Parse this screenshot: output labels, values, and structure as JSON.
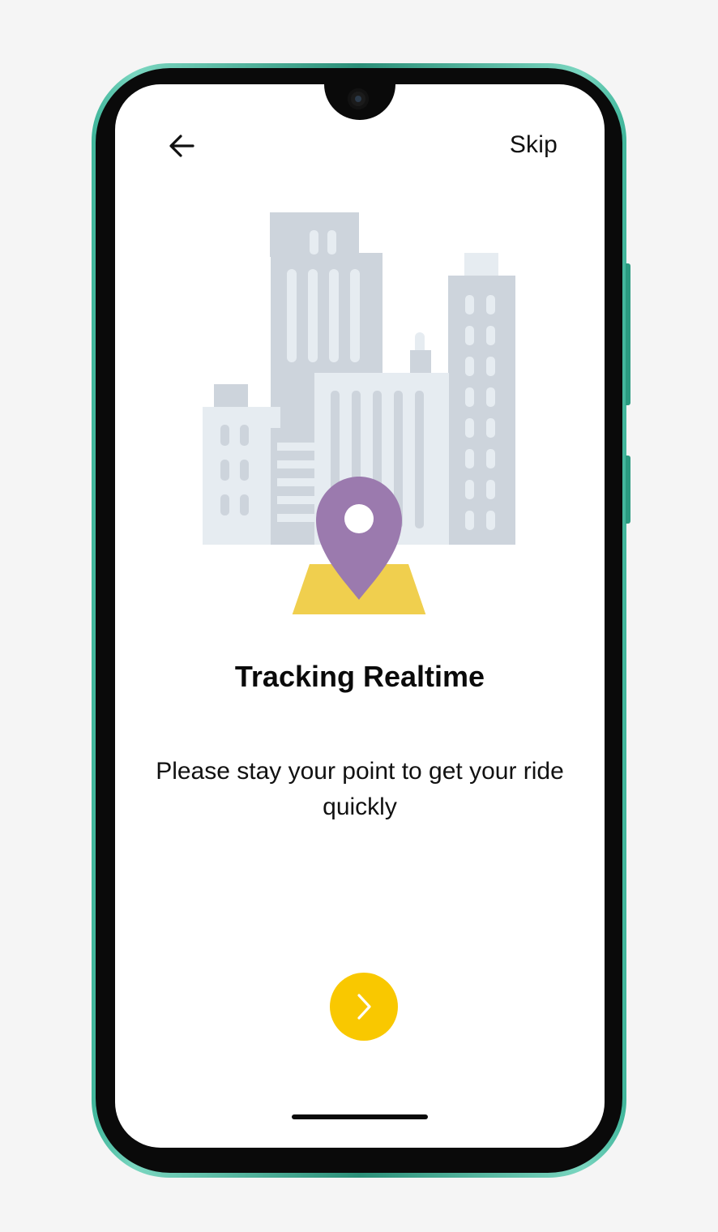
{
  "header": {
    "back_icon": "arrow-left-icon",
    "skip_label": "Skip"
  },
  "onboarding": {
    "illustration": "city-buildings-with-location-pin",
    "title": "Tracking Realtime",
    "description": "Please stay your point to get your ride quickly"
  },
  "footer": {
    "next_icon": "chevron-right-icon"
  },
  "colors": {
    "accent": "#F9C800",
    "pin": "#9B7AAE",
    "map_base": "#F0CF4E",
    "building": "#CDD4DC",
    "building_light": "#E6ECF1"
  }
}
